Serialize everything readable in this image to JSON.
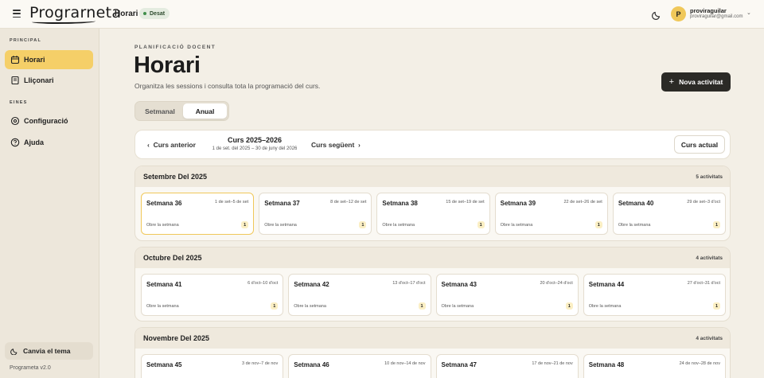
{
  "topbar": {
    "logo": "Prograrneta",
    "crumb": "Horari",
    "status": "Desat",
    "user": {
      "initial": "P",
      "name": "proviraguilar",
      "email": "proviraguilar@gmail.com"
    }
  },
  "sidebar": {
    "sections": [
      {
        "label": "PRINCIPAL",
        "items": [
          {
            "label": "Horari",
            "icon": "calendar-icon",
            "active": true
          },
          {
            "label": "Lliçonari",
            "icon": "book-icon",
            "active": false
          }
        ]
      },
      {
        "label": "EINES",
        "items": [
          {
            "label": "Configuració",
            "icon": "gear-icon",
            "active": false
          },
          {
            "label": "Ajuda",
            "icon": "help-icon",
            "active": false
          }
        ]
      }
    ],
    "theme_button": "Canvia el tema",
    "version": "Programeta v2.0"
  },
  "main": {
    "eyebrow": "PLANIFICACIÓ DOCENT",
    "title": "Horari",
    "subtitle": "Organitza les sessions i consulta tota la programació del curs.",
    "new_button": "Nova activitat",
    "tabs": [
      {
        "label": "Setmanal",
        "active": false
      },
      {
        "label": "Anual",
        "active": true
      }
    ],
    "year": {
      "prev": "Curs anterior",
      "title": "Curs 2025–2026",
      "range": "1 de set. del 2025 – 30 de juny del 2026",
      "next": "Curs següent",
      "current": "Curs actual"
    },
    "months": [
      {
        "name": "Setembre Del 2025",
        "count": "5 activitats",
        "weeks": [
          {
            "name": "Setmana 36",
            "range": "1 de set–5 de set",
            "open": "Obre la setmana",
            "count": "1"
          },
          {
            "name": "Setmana 37",
            "range": "8 de set–12 de set",
            "open": "Obre la setmana",
            "count": "1"
          },
          {
            "name": "Setmana 38",
            "range": "15 de set–19 de set",
            "open": "Obre la setmana",
            "count": "1"
          },
          {
            "name": "Setmana 39",
            "range": "22 de set–26 de set",
            "open": "Obre la setmana",
            "count": "1"
          },
          {
            "name": "Setmana 40",
            "range": "29 de set–3 d'oct",
            "open": "Obre la setmana",
            "count": "1"
          }
        ]
      },
      {
        "name": "Octubre Del 2025",
        "count": "4 activitats",
        "weeks": [
          {
            "name": "Setmana 41",
            "range": "6 d'oct–10 d'oct",
            "open": "Obre la setmana",
            "count": "1"
          },
          {
            "name": "Setmana 42",
            "range": "13 d'oct–17 d'oct",
            "open": "Obre la setmana",
            "count": "1"
          },
          {
            "name": "Setmana 43",
            "range": "20 d'oct–24 d'oct",
            "open": "Obre la setmana",
            "count": "1"
          },
          {
            "name": "Setmana 44",
            "range": "27 d'oct–31 d'oct",
            "open": "Obre la setmana",
            "count": "1"
          }
        ]
      },
      {
        "name": "Novembre Del 2025",
        "count": "4 activitats",
        "weeks": [
          {
            "name": "Setmana 45",
            "range": "3 de nov–7 de nov",
            "open": "",
            "count": ""
          },
          {
            "name": "Setmana 46",
            "range": "10 de nov–14 de nov",
            "open": "",
            "count": ""
          },
          {
            "name": "Setmana 47",
            "range": "17 de nov–21 de nov",
            "open": "",
            "count": ""
          },
          {
            "name": "Setmana 48",
            "range": "24 de nov–28 de nov",
            "open": "",
            "count": ""
          }
        ]
      }
    ]
  },
  "colors": {
    "accent": "#f5cf68",
    "background": "#f3efe6",
    "dark_button": "#2b2a26",
    "saved_dot": "#3f8f49"
  }
}
